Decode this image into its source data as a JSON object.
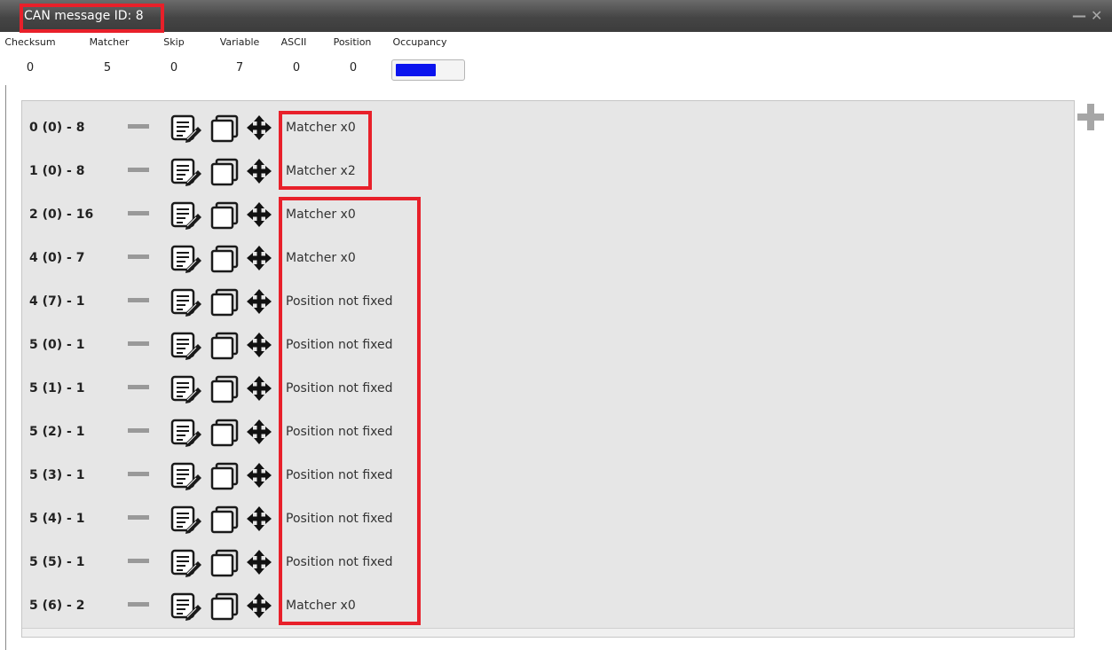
{
  "window": {
    "title": "CAN message ID: 8",
    "minimize_label": "—",
    "close_label": "✕"
  },
  "stats": [
    {
      "label": "Checksum",
      "value": "0"
    },
    {
      "label": "Matcher",
      "value": "5"
    },
    {
      "label": "Skip",
      "value": "0"
    },
    {
      "label": "Variable",
      "value": "7"
    },
    {
      "label": "ASCII",
      "value": "0"
    },
    {
      "label": "Position",
      "value": "0"
    }
  ],
  "occupancy": {
    "label": "Occupancy",
    "fill_fraction": 0.62,
    "fill_color": "#0b14ee"
  },
  "rows": [
    {
      "label": "0 (0) - 8",
      "description": "Matcher x0"
    },
    {
      "label": "1 (0) - 8",
      "description": "Matcher x2"
    },
    {
      "label": "2 (0) - 16",
      "description": "Matcher x0"
    },
    {
      "label": "4 (0) - 7",
      "description": "Matcher x0"
    },
    {
      "label": "4 (7) - 1",
      "description": "Position not fixed"
    },
    {
      "label": "5 (0) - 1",
      "description": "Position not fixed"
    },
    {
      "label": "5 (1) - 1",
      "description": "Position not fixed"
    },
    {
      "label": "5 (2) - 1",
      "description": "Position not fixed"
    },
    {
      "label": "5 (3) - 1",
      "description": "Position not fixed"
    },
    {
      "label": "5 (4) - 1",
      "description": "Position not fixed"
    },
    {
      "label": "5 (5) - 1",
      "description": "Position not fixed"
    },
    {
      "label": "5 (6) - 2",
      "description": "Matcher x0"
    }
  ],
  "icons": {
    "row_remove": "minus-icon",
    "row_edit": "edit-list-icon",
    "row_copy": "copy-icon",
    "row_move": "move-arrows-icon",
    "add": "plus-icon"
  },
  "colors": {
    "highlight": "#e8202a",
    "panel_background": "#e6e6e6",
    "titlebar": "#454545"
  }
}
